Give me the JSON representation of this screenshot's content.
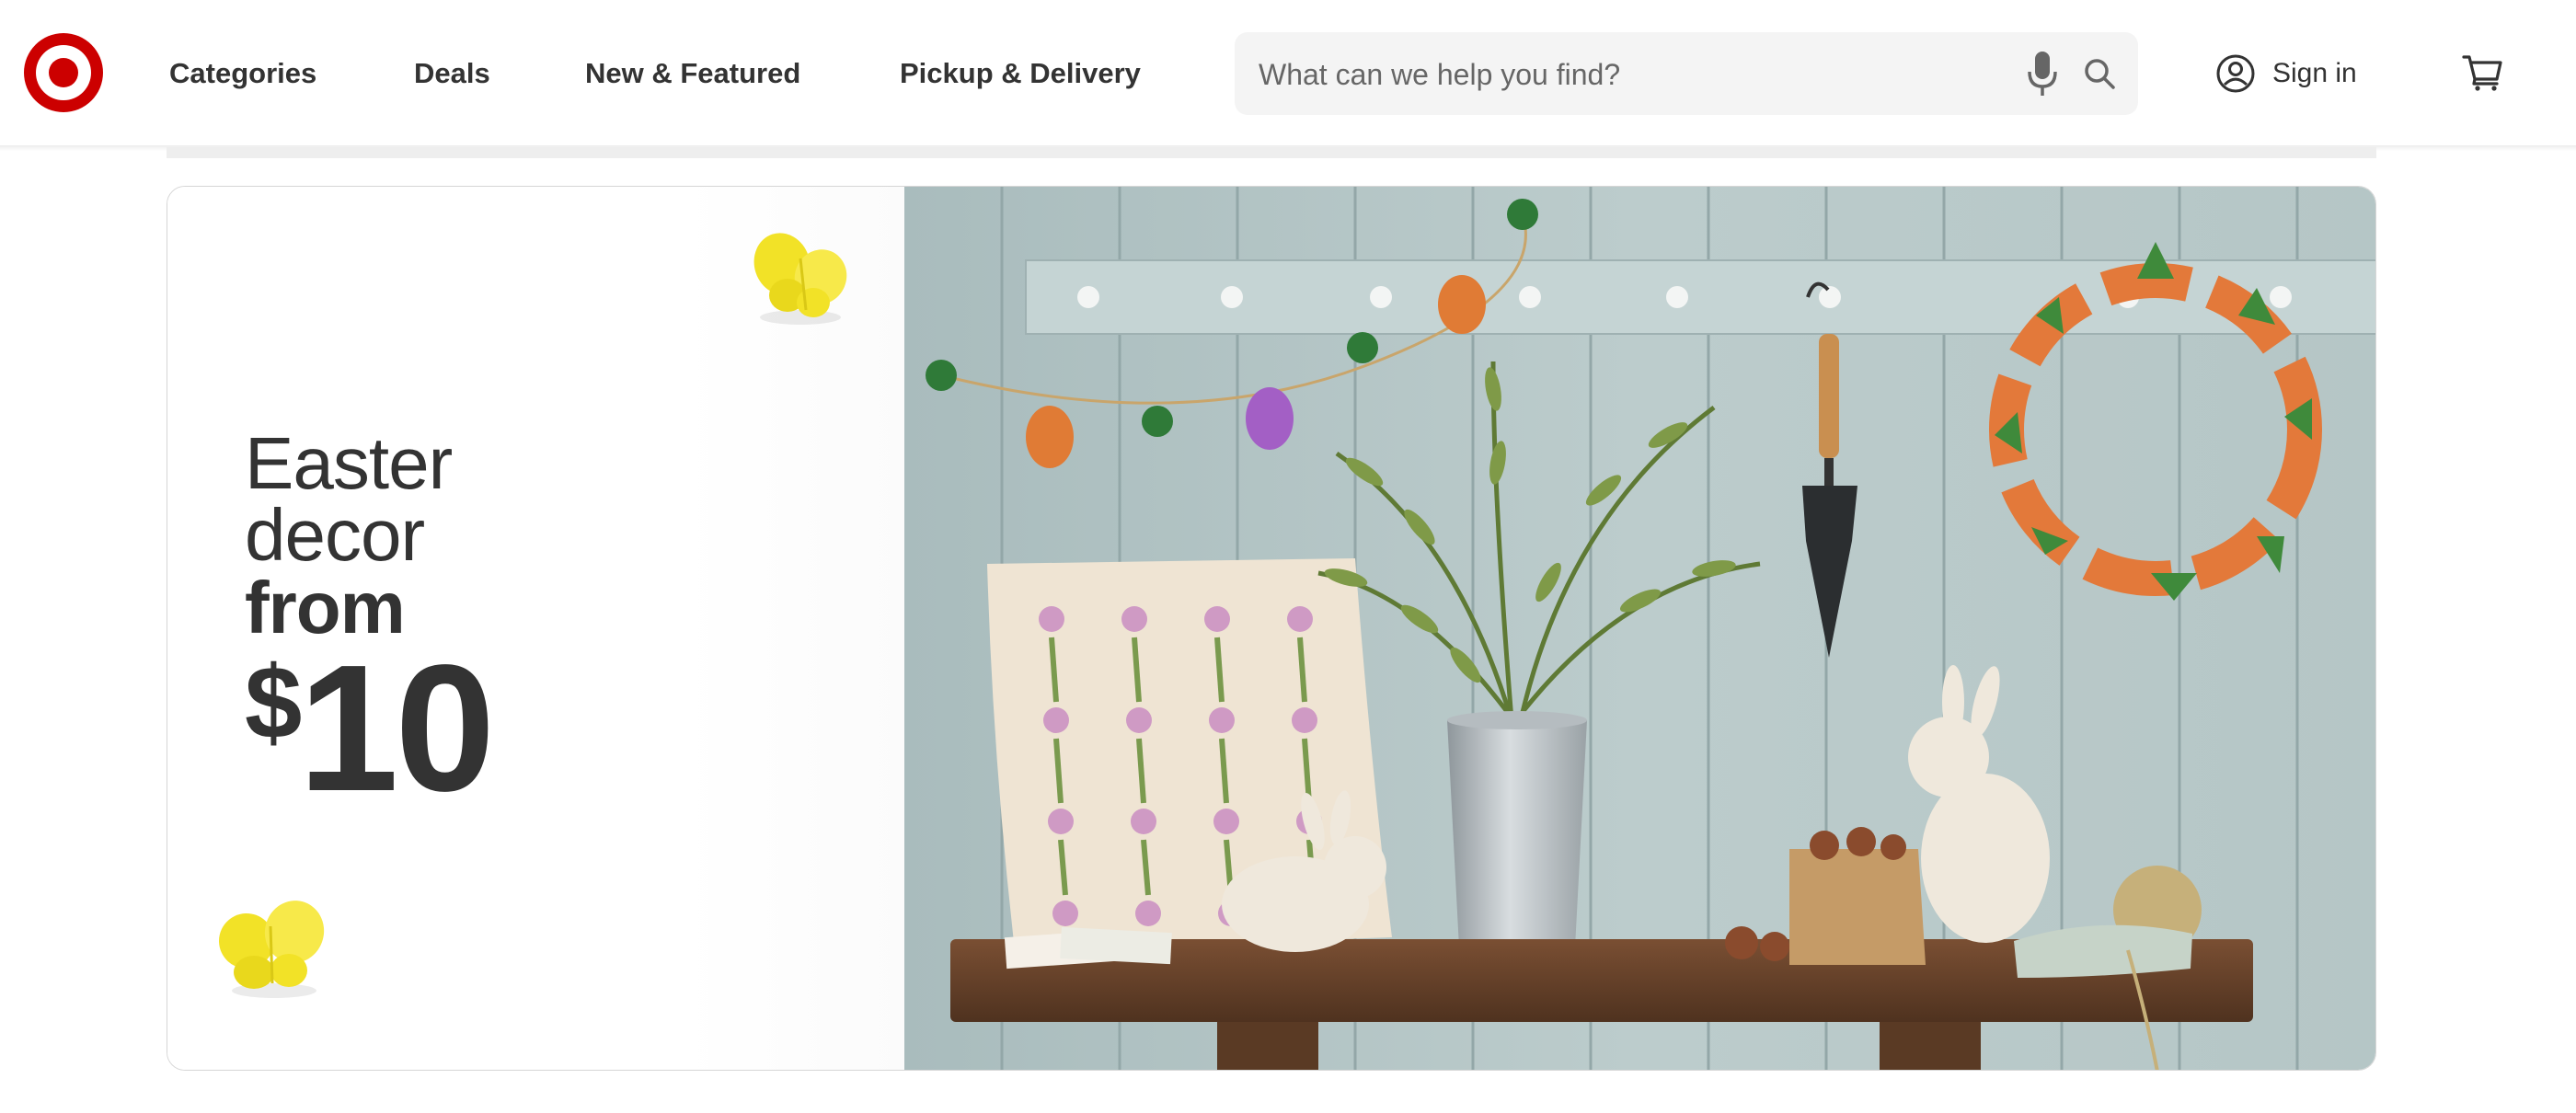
{
  "header": {
    "logo_name": "target-bullseye-logo",
    "nav": [
      {
        "label": "Categories"
      },
      {
        "label": "Deals"
      },
      {
        "label": "New & Featured"
      },
      {
        "label": "Pickup & Delivery"
      }
    ],
    "search": {
      "placeholder": "What can we help you find?",
      "value": ""
    },
    "sign_in": "Sign in",
    "icons": [
      "microphone-icon",
      "search-icon",
      "account-icon",
      "cart-icon"
    ]
  },
  "banner": {
    "headline": {
      "line1": "Easter",
      "line2": "decor",
      "line3": "from",
      "price_symbol": "$",
      "price_value": "10"
    }
  },
  "colors": {
    "brand_red": "#cc0000",
    "text_dark": "#333333",
    "search_bg": "#f4f4f4",
    "butterfly_yellow": "#f2e227"
  }
}
